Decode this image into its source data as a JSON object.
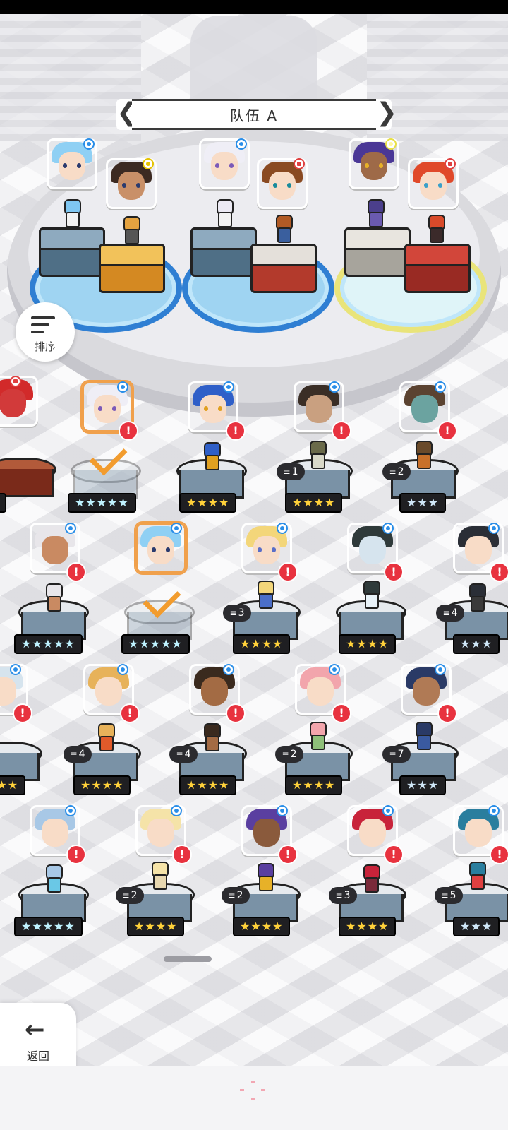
{
  "team": {
    "title": "队伍 A",
    "prev": "❮",
    "next": "❯"
  },
  "sort": {
    "label": "排序"
  },
  "back": {
    "label": "返回",
    "arrow": "←"
  },
  "roster": {
    "alert_symbol": "!",
    "dup_icon": "≡",
    "rows": [
      [
        {
          "stars": "★",
          "tier": "gold",
          "dup": ""
        },
        {
          "stars": "★★★★★",
          "tier": "cyan",
          "dup": "",
          "selected": true
        },
        {
          "stars": "★★★★",
          "tier": "gold",
          "dup": ""
        },
        {
          "stars": "★★★★",
          "tier": "gold",
          "dup": "1"
        },
        {
          "stars": "★★★",
          "tier": "silver",
          "dup": "2"
        }
      ],
      [
        {
          "stars": "★★★★★",
          "tier": "cyan",
          "dup": ""
        },
        {
          "stars": "★★★★★",
          "tier": "cyan",
          "dup": "",
          "selected": true
        },
        {
          "stars": "★★★★",
          "tier": "gold",
          "dup": "3"
        },
        {
          "stars": "★★★★",
          "tier": "gold",
          "dup": ""
        },
        {
          "stars": "★★★",
          "tier": "silver",
          "dup": "4"
        }
      ],
      [
        {
          "stars": "★★★",
          "tier": "gold",
          "dup": ""
        },
        {
          "stars": "★★★★",
          "tier": "gold",
          "dup": "4"
        },
        {
          "stars": "★★★★",
          "tier": "gold",
          "dup": "4"
        },
        {
          "stars": "★★★★",
          "tier": "gold",
          "dup": "2"
        },
        {
          "stars": "★★★",
          "tier": "silver",
          "dup": "7"
        }
      ],
      [
        {
          "stars": "★★★★★",
          "tier": "cyan",
          "dup": ""
        },
        {
          "stars": "★★★★",
          "tier": "gold",
          "dup": "2"
        },
        {
          "stars": "★★★★",
          "tier": "gold",
          "dup": "2"
        },
        {
          "stars": "★★★★",
          "tier": "gold",
          "dup": "3"
        },
        {
          "stars": "★★★",
          "tier": "silver",
          "dup": "5"
        }
      ]
    ]
  },
  "colors": {
    "accent_blue": "#2a8ee8",
    "alert_red": "#e8323f",
    "selection_orange": "#f0a04b",
    "star_gold": "#ffd13a"
  }
}
